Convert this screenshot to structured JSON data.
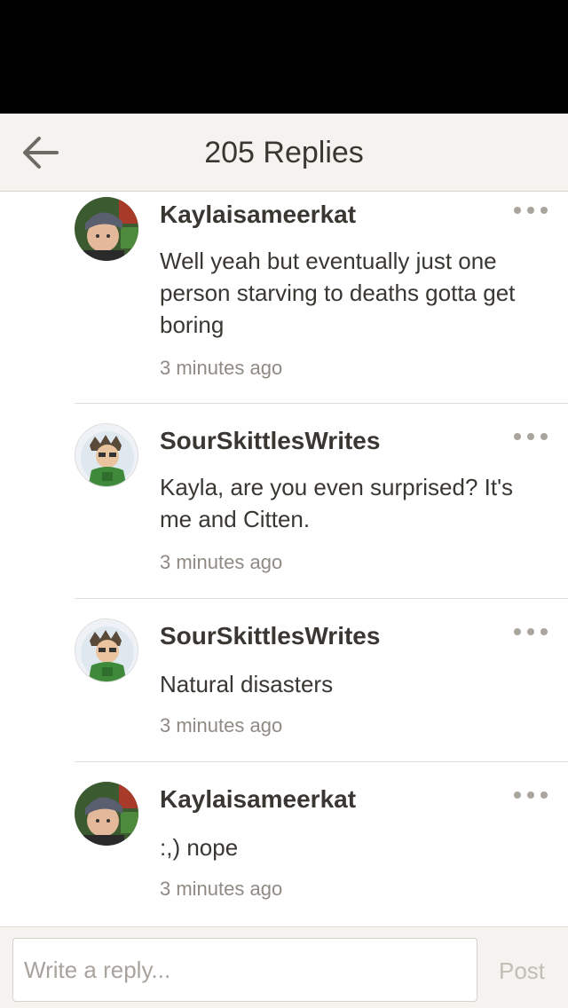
{
  "header": {
    "title": "205 Replies",
    "back_icon": "arrow-left-icon"
  },
  "comments": [
    {
      "author": "Kaylaisameerkat",
      "text": "Well yeah but eventually just one person starving to deaths gotta get boring",
      "time": "3 minutes ago",
      "more_icon": "more-dots-icon"
    },
    {
      "author": "SourSkittlesWrites",
      "text": "Kayla, are you even surprised? It's me and Citten.",
      "time": "3 minutes ago",
      "more_icon": "more-dots-icon"
    },
    {
      "author": "SourSkittlesWrites",
      "text": "Natural disasters",
      "time": "3 minutes ago",
      "more_icon": "more-dots-icon"
    },
    {
      "author": "Kaylaisameerkat",
      "text": ":,) nope",
      "time": "3 minutes ago",
      "more_icon": "more-dots-icon"
    }
  ],
  "footer": {
    "placeholder": "Write a reply...",
    "post_label": "Post"
  },
  "colors": {
    "header_bg": "#f5f3ef",
    "text": "#3a3733",
    "muted": "#8f8a83",
    "divider": "#e1ddd6"
  }
}
